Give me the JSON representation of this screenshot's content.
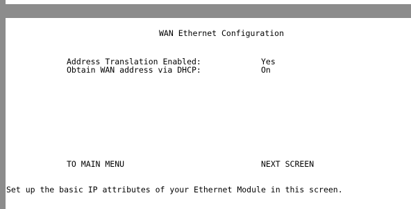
{
  "screen": {
    "title": "WAN Ethernet Configuration",
    "fields": [
      {
        "label": "Address Translation Enabled:",
        "value": "Yes"
      },
      {
        "label": "Obtain WAN address via DHCP:",
        "value": "On"
      }
    ],
    "nav": {
      "main_menu": "TO MAIN MENU",
      "next_screen": "NEXT SCREEN"
    },
    "help_text": "Set up the basic IP attributes of your Ethernet Module in this screen."
  }
}
